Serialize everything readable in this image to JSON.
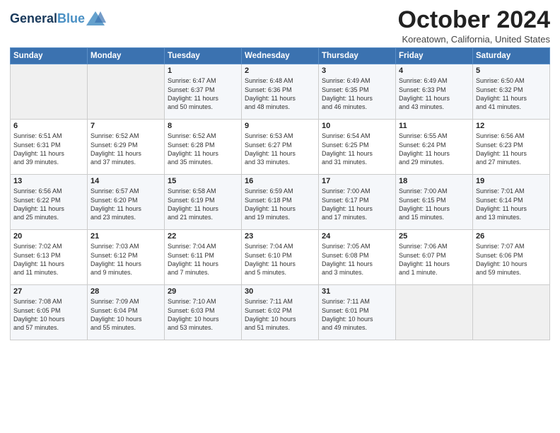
{
  "header": {
    "logo_line1": "General",
    "logo_line2": "Blue",
    "month": "October 2024",
    "location": "Koreatown, California, United States"
  },
  "days_of_week": [
    "Sunday",
    "Monday",
    "Tuesday",
    "Wednesday",
    "Thursday",
    "Friday",
    "Saturday"
  ],
  "weeks": [
    [
      {
        "day": "",
        "content": ""
      },
      {
        "day": "",
        "content": ""
      },
      {
        "day": "1",
        "content": "Sunrise: 6:47 AM\nSunset: 6:37 PM\nDaylight: 11 hours\nand 50 minutes."
      },
      {
        "day": "2",
        "content": "Sunrise: 6:48 AM\nSunset: 6:36 PM\nDaylight: 11 hours\nand 48 minutes."
      },
      {
        "day": "3",
        "content": "Sunrise: 6:49 AM\nSunset: 6:35 PM\nDaylight: 11 hours\nand 46 minutes."
      },
      {
        "day": "4",
        "content": "Sunrise: 6:49 AM\nSunset: 6:33 PM\nDaylight: 11 hours\nand 43 minutes."
      },
      {
        "day": "5",
        "content": "Sunrise: 6:50 AM\nSunset: 6:32 PM\nDaylight: 11 hours\nand 41 minutes."
      }
    ],
    [
      {
        "day": "6",
        "content": "Sunrise: 6:51 AM\nSunset: 6:31 PM\nDaylight: 11 hours\nand 39 minutes."
      },
      {
        "day": "7",
        "content": "Sunrise: 6:52 AM\nSunset: 6:29 PM\nDaylight: 11 hours\nand 37 minutes."
      },
      {
        "day": "8",
        "content": "Sunrise: 6:52 AM\nSunset: 6:28 PM\nDaylight: 11 hours\nand 35 minutes."
      },
      {
        "day": "9",
        "content": "Sunrise: 6:53 AM\nSunset: 6:27 PM\nDaylight: 11 hours\nand 33 minutes."
      },
      {
        "day": "10",
        "content": "Sunrise: 6:54 AM\nSunset: 6:25 PM\nDaylight: 11 hours\nand 31 minutes."
      },
      {
        "day": "11",
        "content": "Sunrise: 6:55 AM\nSunset: 6:24 PM\nDaylight: 11 hours\nand 29 minutes."
      },
      {
        "day": "12",
        "content": "Sunrise: 6:56 AM\nSunset: 6:23 PM\nDaylight: 11 hours\nand 27 minutes."
      }
    ],
    [
      {
        "day": "13",
        "content": "Sunrise: 6:56 AM\nSunset: 6:22 PM\nDaylight: 11 hours\nand 25 minutes."
      },
      {
        "day": "14",
        "content": "Sunrise: 6:57 AM\nSunset: 6:20 PM\nDaylight: 11 hours\nand 23 minutes."
      },
      {
        "day": "15",
        "content": "Sunrise: 6:58 AM\nSunset: 6:19 PM\nDaylight: 11 hours\nand 21 minutes."
      },
      {
        "day": "16",
        "content": "Sunrise: 6:59 AM\nSunset: 6:18 PM\nDaylight: 11 hours\nand 19 minutes."
      },
      {
        "day": "17",
        "content": "Sunrise: 7:00 AM\nSunset: 6:17 PM\nDaylight: 11 hours\nand 17 minutes."
      },
      {
        "day": "18",
        "content": "Sunrise: 7:00 AM\nSunset: 6:15 PM\nDaylight: 11 hours\nand 15 minutes."
      },
      {
        "day": "19",
        "content": "Sunrise: 7:01 AM\nSunset: 6:14 PM\nDaylight: 11 hours\nand 13 minutes."
      }
    ],
    [
      {
        "day": "20",
        "content": "Sunrise: 7:02 AM\nSunset: 6:13 PM\nDaylight: 11 hours\nand 11 minutes."
      },
      {
        "day": "21",
        "content": "Sunrise: 7:03 AM\nSunset: 6:12 PM\nDaylight: 11 hours\nand 9 minutes."
      },
      {
        "day": "22",
        "content": "Sunrise: 7:04 AM\nSunset: 6:11 PM\nDaylight: 11 hours\nand 7 minutes."
      },
      {
        "day": "23",
        "content": "Sunrise: 7:04 AM\nSunset: 6:10 PM\nDaylight: 11 hours\nand 5 minutes."
      },
      {
        "day": "24",
        "content": "Sunrise: 7:05 AM\nSunset: 6:08 PM\nDaylight: 11 hours\nand 3 minutes."
      },
      {
        "day": "25",
        "content": "Sunrise: 7:06 AM\nSunset: 6:07 PM\nDaylight: 11 hours\nand 1 minute."
      },
      {
        "day": "26",
        "content": "Sunrise: 7:07 AM\nSunset: 6:06 PM\nDaylight: 10 hours\nand 59 minutes."
      }
    ],
    [
      {
        "day": "27",
        "content": "Sunrise: 7:08 AM\nSunset: 6:05 PM\nDaylight: 10 hours\nand 57 minutes."
      },
      {
        "day": "28",
        "content": "Sunrise: 7:09 AM\nSunset: 6:04 PM\nDaylight: 10 hours\nand 55 minutes."
      },
      {
        "day": "29",
        "content": "Sunrise: 7:10 AM\nSunset: 6:03 PM\nDaylight: 10 hours\nand 53 minutes."
      },
      {
        "day": "30",
        "content": "Sunrise: 7:11 AM\nSunset: 6:02 PM\nDaylight: 10 hours\nand 51 minutes."
      },
      {
        "day": "31",
        "content": "Sunrise: 7:11 AM\nSunset: 6:01 PM\nDaylight: 10 hours\nand 49 minutes."
      },
      {
        "day": "",
        "content": ""
      },
      {
        "day": "",
        "content": ""
      }
    ]
  ]
}
